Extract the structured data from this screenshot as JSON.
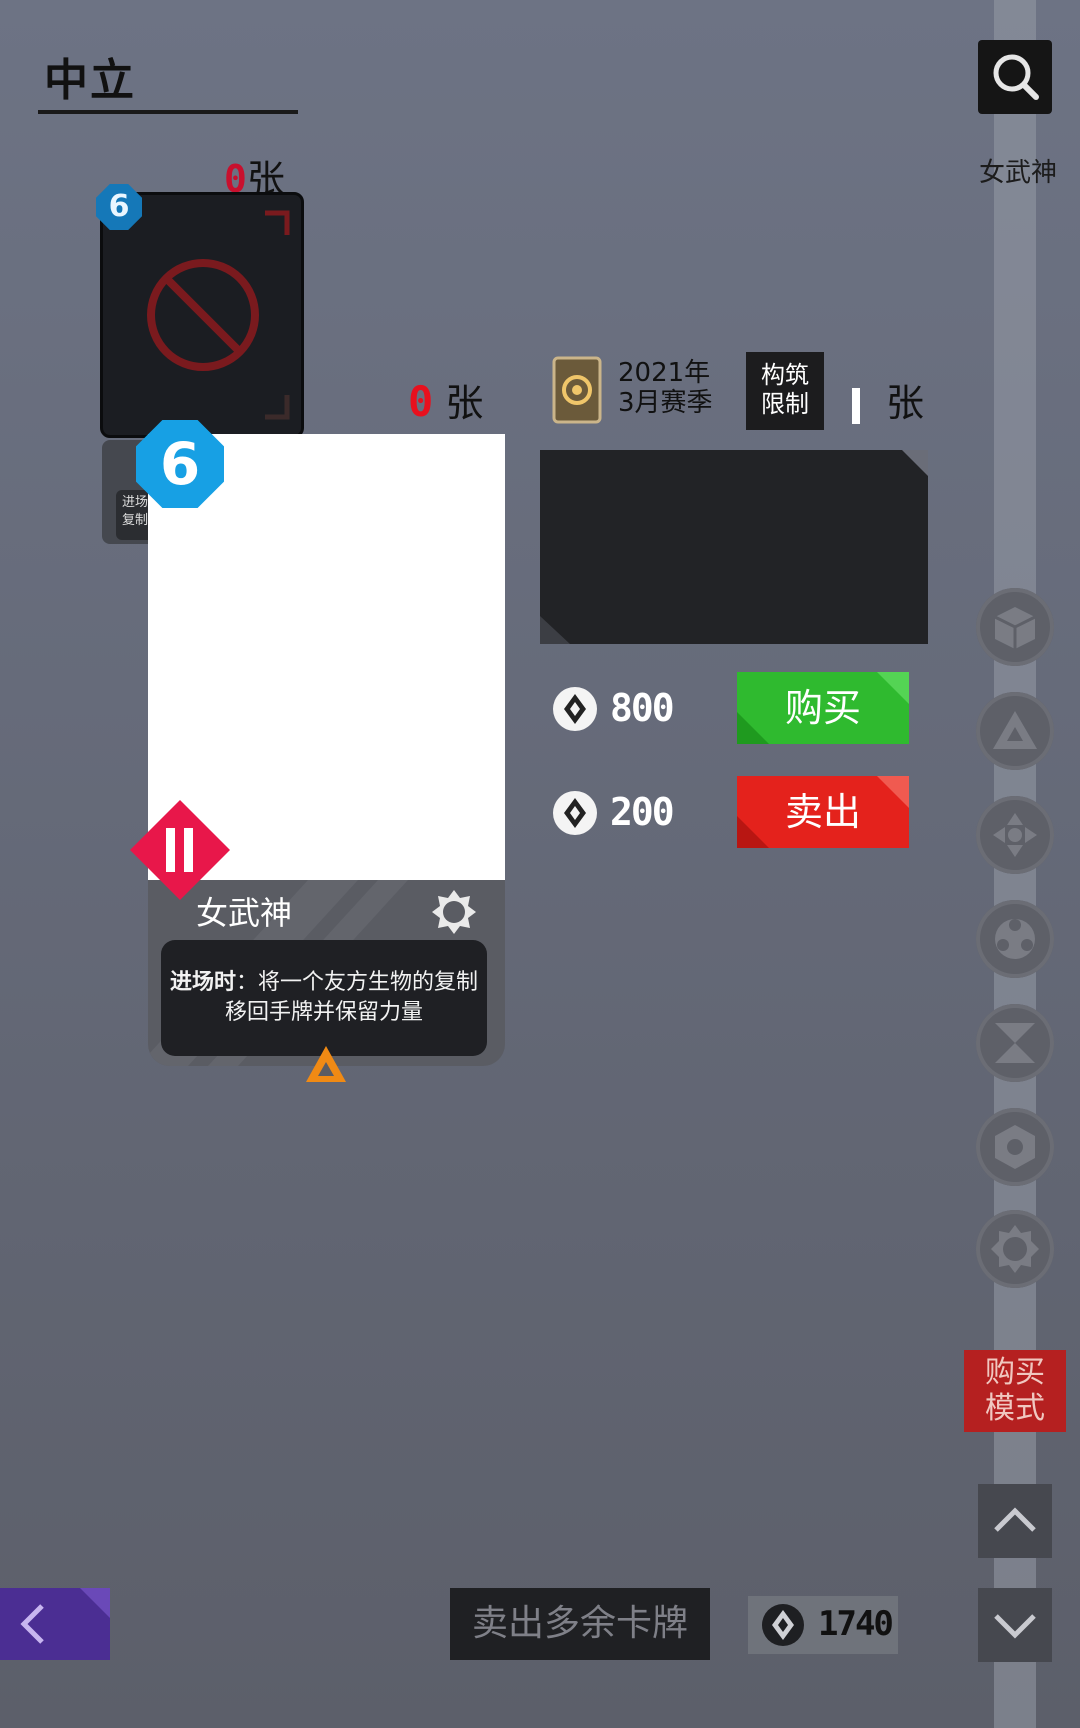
{
  "category": {
    "title": "中立"
  },
  "search": {
    "label": "女武神",
    "icon": "search-icon"
  },
  "mini_card": {
    "count_value": "0",
    "count_unit": "张",
    "cost": "6",
    "footer_text": "进场时：复制"
  },
  "card": {
    "count_value": "0",
    "count_unit": "张",
    "cost": "6",
    "name": "女武神",
    "ability_label": "进场时",
    "ability_text": "：将一个友方生物的复制移回手牌并保留力量",
    "rank_color": "#e8174a",
    "cost_color": "#17a0e4"
  },
  "info": {
    "season_line1": "2021年",
    "season_line2": "3月赛季",
    "limit_line1": "构筑",
    "limit_line2": "限制",
    "owned_unit": "张"
  },
  "trade": {
    "buy_price": "800",
    "buy_label": "购买",
    "sell_price": "200",
    "sell_label": "卖出",
    "buy_color": "#2fba2f",
    "sell_color": "#e4221c"
  },
  "side_filters": [
    "cube-icon",
    "triangle-icon",
    "arrows-icon",
    "circles-icon",
    "hourglass-icon",
    "hexagon-icon",
    "gear-icon"
  ],
  "buy_mode": {
    "line1": "购买",
    "line2": "模式"
  },
  "bottom": {
    "sell_extra_label": "卖出多余卡牌",
    "wallet_amount": "1740"
  }
}
